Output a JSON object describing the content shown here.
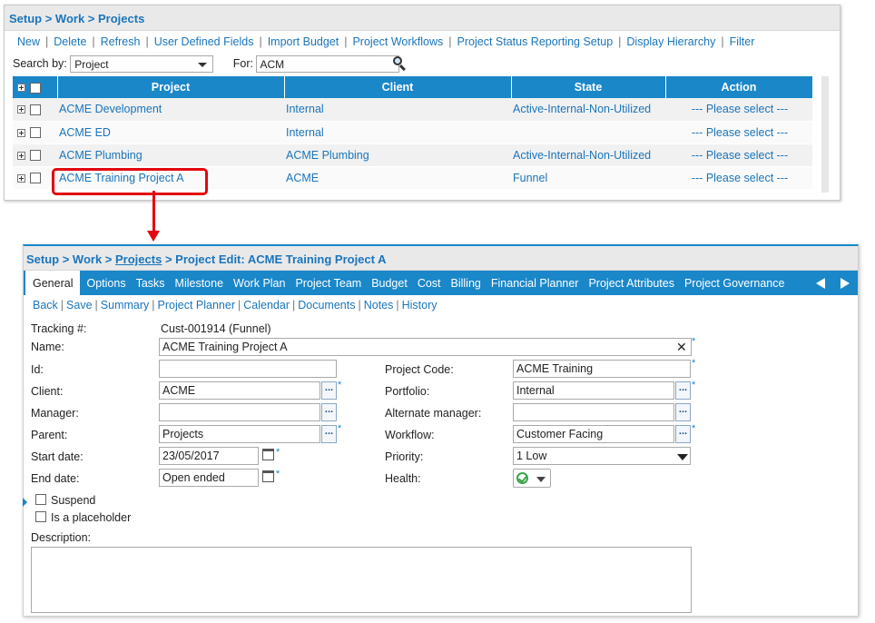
{
  "top": {
    "breadcrumb": "Setup > Work > Projects",
    "toolbar": [
      "New",
      "Delete",
      "Refresh",
      "User Defined Fields",
      "Import Budget",
      "Project Workflows",
      "Project Status Reporting Setup",
      "Display Hierarchy",
      "Filter"
    ],
    "search_by_label": "Search by:",
    "search_by_value": "Project",
    "for_label": "For:",
    "for_value": "ACM",
    "columns": [
      "Project",
      "Client",
      "State",
      "Action"
    ],
    "rows": [
      {
        "project": "ACME Development",
        "client": "Internal",
        "state": "Active-Internal-Non-Utilized",
        "action": "--- Please select ---"
      },
      {
        "project": "ACME ED",
        "client": "Internal",
        "state": "",
        "action": "--- Please select ---"
      },
      {
        "project": "ACME Plumbing",
        "client": "ACME Plumbing",
        "state": "Active-Internal-Non-Utilized",
        "action": "--- Please select ---"
      },
      {
        "project": "ACME Training Project A",
        "client": "ACME",
        "state": "Funnel",
        "action": "--- Please select ---"
      }
    ]
  },
  "edit": {
    "breadcrumb_start": "Setup > Work > ",
    "breadcrumb_link": "Projects",
    "breadcrumb_end": " > Project Edit: ACME Training Project A",
    "tabs": [
      "General",
      "Options",
      "Tasks",
      "Milestone",
      "Work Plan",
      "Project Team",
      "Budget",
      "Cost",
      "Billing",
      "Financial Planner",
      "Project Attributes",
      "Project Governance"
    ],
    "sublinks": [
      "Back",
      "Save",
      "Summary",
      "Project Planner",
      "Calendar",
      "Documents",
      "Notes",
      "History"
    ],
    "tracking_label": "Tracking #:",
    "tracking_value": "Cust-001914 (Funnel)",
    "name_label": "Name:",
    "name_value": "ACME Training Project A",
    "id_label": "Id:",
    "id_value": "",
    "client_label": "Client:",
    "client_value": "ACME",
    "manager_label": "Manager:",
    "manager_value": "",
    "parent_label": "Parent:",
    "parent_value": "Projects",
    "start_label": "Start date:",
    "start_value": "23/05/2017",
    "end_label": "End date:",
    "end_value": "Open ended",
    "code_label": "Project Code:",
    "code_value": "ACME Training",
    "portfolio_label": "Portfolio:",
    "portfolio_value": "Internal",
    "altmgr_label": "Alternate manager:",
    "altmgr_value": "",
    "workflow_label": "Workflow:",
    "workflow_value": "Customer Facing",
    "priority_label": "Priority:",
    "priority_value": "1 Low",
    "health_label": "Health:",
    "suspend_label": "Suspend",
    "placeholder_label": "Is a placeholder",
    "description_label": "Description:",
    "dots": "...",
    "required_mark": "*",
    "clear_glyph": "✕"
  }
}
